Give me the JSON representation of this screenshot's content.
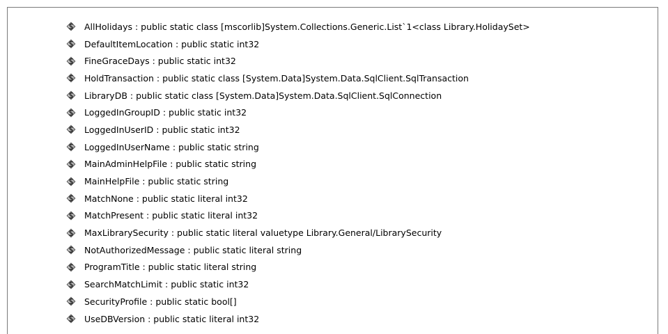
{
  "fields": [
    {
      "label": "AllHolidays : public static class [mscorlib]System.Collections.Generic.List`1<class Library.HolidaySet>",
      "icon": "static-field-icon"
    },
    {
      "label": "DefaultItemLocation : public static int32",
      "icon": "static-field-icon"
    },
    {
      "label": "FineGraceDays : public static int32",
      "icon": "static-field-icon"
    },
    {
      "label": "HoldTransaction : public static class [System.Data]System.Data.SqlClient.SqlTransaction",
      "icon": "static-field-icon"
    },
    {
      "label": "LibraryDB : public static class [System.Data]System.Data.SqlClient.SqlConnection",
      "icon": "static-field-icon"
    },
    {
      "label": "LoggedInGroupID : public static int32",
      "icon": "static-field-icon"
    },
    {
      "label": "LoggedInUserID : public static int32",
      "icon": "static-field-icon"
    },
    {
      "label": "LoggedInUserName : public static string",
      "icon": "static-field-icon"
    },
    {
      "label": "MainAdminHelpFile : public static string",
      "icon": "static-field-icon"
    },
    {
      "label": "MainHelpFile : public static string",
      "icon": "static-field-icon"
    },
    {
      "label": "MatchNone : public static literal int32",
      "icon": "static-field-icon"
    },
    {
      "label": "MatchPresent : public static literal int32",
      "icon": "static-field-icon"
    },
    {
      "label": "MaxLibrarySecurity : public static literal valuetype Library.General/LibrarySecurity",
      "icon": "static-field-icon"
    },
    {
      "label": "NotAuthorizedMessage : public static literal string",
      "icon": "static-field-icon"
    },
    {
      "label": "ProgramTitle : public static literal string",
      "icon": "static-field-icon"
    },
    {
      "label": "SearchMatchLimit : public static int32",
      "icon": "static-field-icon"
    },
    {
      "label": "SecurityProfile : public static bool[]",
      "icon": "static-field-icon"
    },
    {
      "label": "UseDBVersion : public static literal int32",
      "icon": "static-field-icon"
    }
  ]
}
